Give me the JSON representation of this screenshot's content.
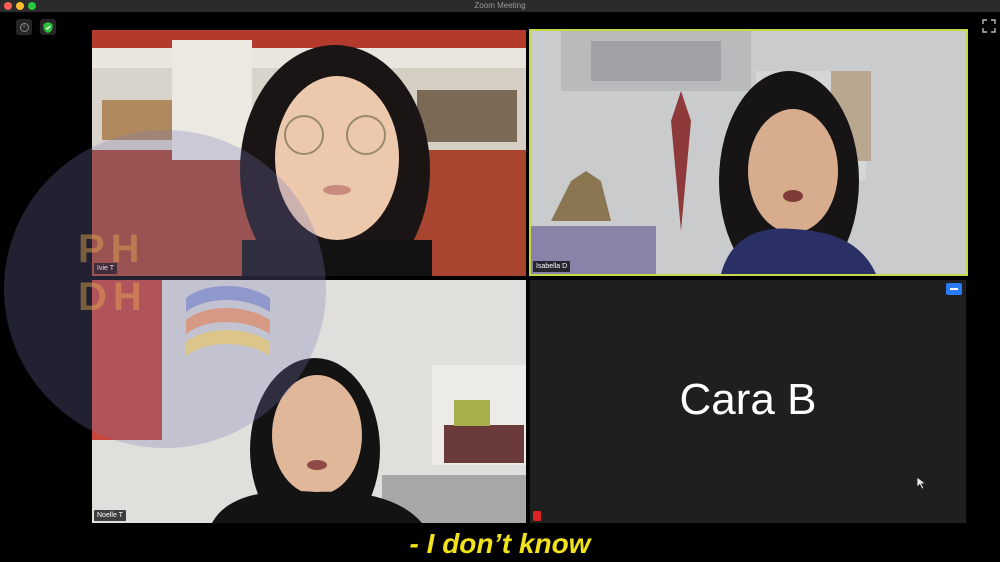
{
  "window": {
    "title": "Zoom Meeting"
  },
  "participants": [
    {
      "name": "Ivie T"
    },
    {
      "name": "Isabella D"
    },
    {
      "name": "Noelle T"
    },
    {
      "name": "Cara B"
    }
  ],
  "watermark": {
    "letters_top": "PH",
    "letters_bottom": "DH"
  },
  "subtitle": "-  I don’t know",
  "colors": {
    "active_speaker_border": "#c6d94a",
    "subtitle": "#f2e21a",
    "menu_button": "#2a7cf6"
  }
}
